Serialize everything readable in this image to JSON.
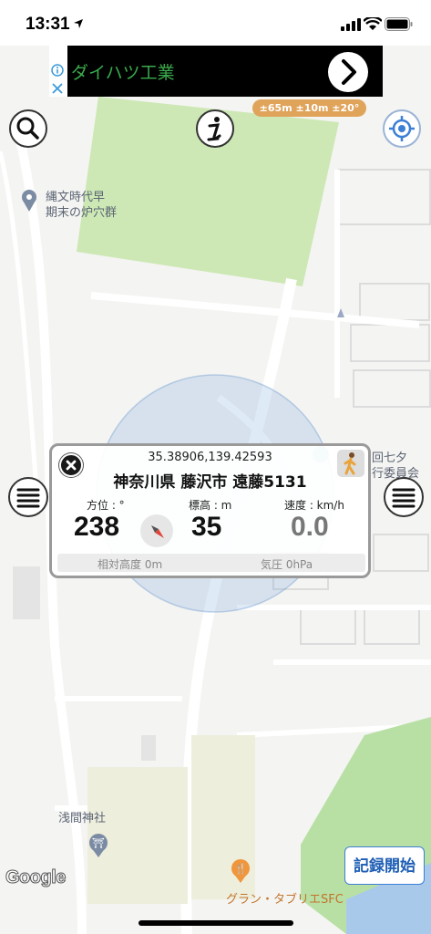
{
  "status_bar": {
    "time": "13:31"
  },
  "ad": {
    "text": "ダイハツ工業"
  },
  "accuracy_badge": "±65m ±10m ±20°",
  "map_labels": {
    "poi_1": [
      "縄文時代早",
      "期末の炉穴群"
    ],
    "poi_2": [
      "回七夕",
      "行委員会"
    ],
    "shrine": "浅間神社",
    "restaurant": "グラン・タブリエSFC"
  },
  "card": {
    "coordinates": "35.38906,139.42593",
    "address": "神奈川県 藤沢市 遠藤5131",
    "heading": {
      "label": "方位 : °",
      "value": "238"
    },
    "altitude": {
      "label": "標高 : m",
      "value": "35"
    },
    "speed": {
      "label": "速度 : km/h",
      "value": "0.0"
    },
    "relative_altitude": "相対高度 0m",
    "pressure": "気圧 0hPa"
  },
  "google_logo": "Google",
  "record_button": "記録開始",
  "colors": {
    "accent": "#3c7fd6",
    "badge": "#e0a35a",
    "park": "#cde8b5"
  }
}
